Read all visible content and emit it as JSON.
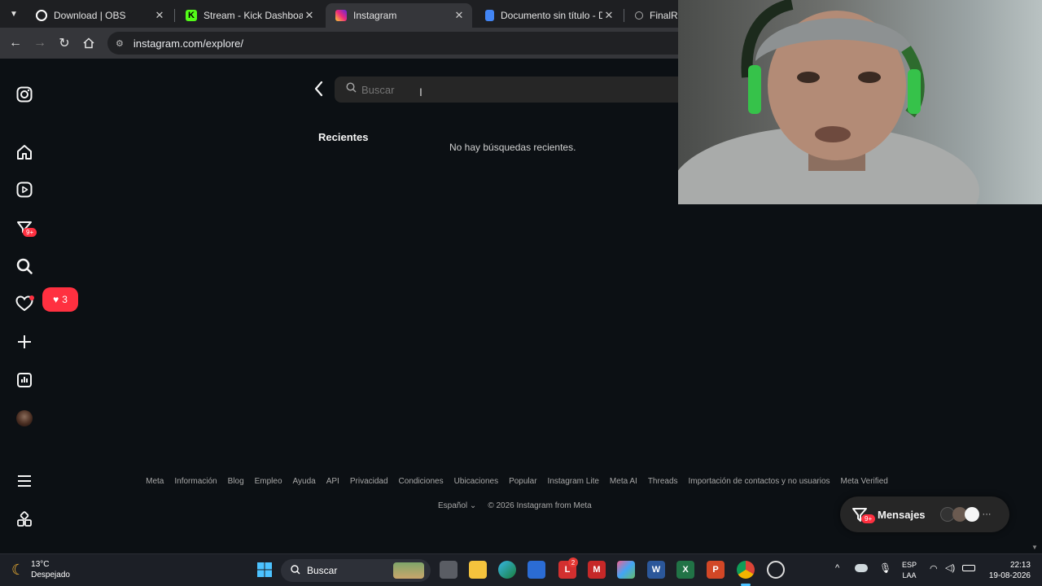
{
  "browser": {
    "tabs": [
      {
        "label": "Download | OBS",
        "icon": "obs-icon",
        "color": "#ffffff"
      },
      {
        "label": "Stream - Kick Dashboard",
        "icon": "kick-icon",
        "color": "#53fc18"
      },
      {
        "label": "Instagram",
        "icon": "instagram-icon",
        "color": "#e1306c"
      },
      {
        "label": "Documento sin título - Docu",
        "icon": "docs-icon",
        "color": "#4285f4"
      },
      {
        "label": "FinalRep",
        "icon": "finalrep-icon",
        "color": "#ffffff"
      }
    ],
    "url": "instagram.com/explore/"
  },
  "sidebar": {
    "items": [
      {
        "name": "home",
        "icon": "home-icon"
      },
      {
        "name": "reels",
        "icon": "reels-icon"
      },
      {
        "name": "messages",
        "icon": "messenger-icon",
        "badge": "9+"
      },
      {
        "name": "search",
        "icon": "search-icon"
      },
      {
        "name": "notifications",
        "icon": "heart-icon",
        "popup_count": "3"
      },
      {
        "name": "create",
        "icon": "plus-icon"
      },
      {
        "name": "dashboard",
        "icon": "chart-icon"
      },
      {
        "name": "profile",
        "icon": "avatar"
      }
    ]
  },
  "search": {
    "placeholder": "Buscar",
    "recent_heading": "Recientes",
    "empty_text": "No hay búsquedas recientes."
  },
  "footer": {
    "links": [
      "Meta",
      "Información",
      "Blog",
      "Empleo",
      "Ayuda",
      "API",
      "Privacidad",
      "Condiciones",
      "Ubicaciones",
      "Popular",
      "Instagram Lite",
      "Meta AI",
      "Threads",
      "Importación de contactos y no usuarios",
      "Meta Verified"
    ],
    "language": "Español",
    "copyright": "© 2026 Instagram from Meta"
  },
  "messages_pill": {
    "label": "Mensajes",
    "badge": "9+"
  },
  "taskbar": {
    "weather_temp": "13°C",
    "weather_desc": "Despejado",
    "search_label": "Buscar",
    "mail_badge": "2",
    "lang_top": "ESP",
    "lang_bottom": "LAA",
    "time": "22:13",
    "date": "19-08-2026"
  },
  "colors": {
    "accent_red": "#ff3040",
    "bg": "#0c1014"
  }
}
